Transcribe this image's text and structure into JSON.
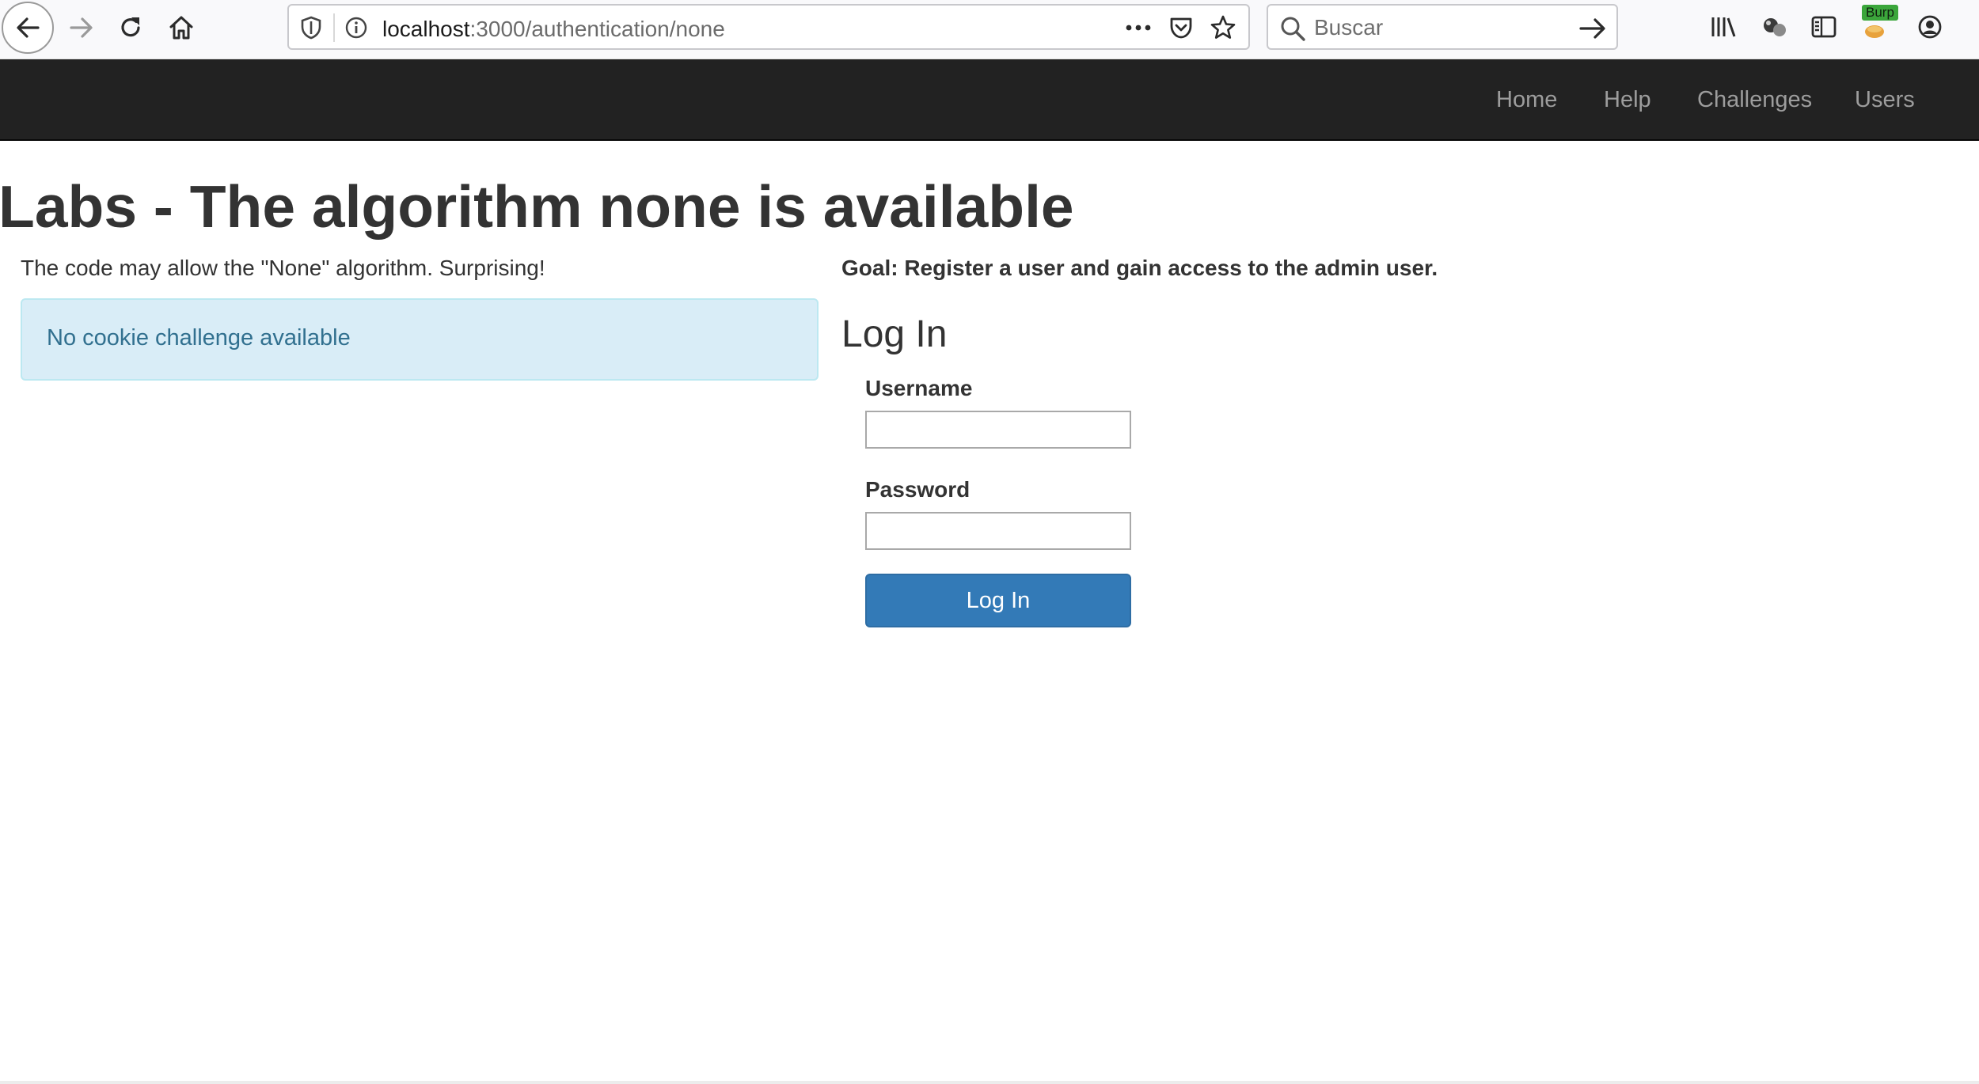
{
  "browser": {
    "url_host": "localhost",
    "url_path": ":3000/authentication/none",
    "search_placeholder": "Buscar",
    "burp_badge": "Burp",
    "icons": [
      "back-arrow-icon",
      "forward-arrow-icon",
      "reload-icon",
      "home-icon",
      "shield-icon",
      "info-icon",
      "more-dots-icon",
      "pocket-icon",
      "star-icon",
      "search-icon",
      "go-arrow-icon",
      "library-icon",
      "extension-icon",
      "sidebar-icon",
      "burp-icon",
      "account-icon"
    ]
  },
  "nav": {
    "items": [
      "Home",
      "Help",
      "Challenges",
      "Users"
    ]
  },
  "page": {
    "title": "Labs - The algorithm none is available",
    "lead": "The code may allow the \"None\" algorithm. Surprising!",
    "alert": "No cookie challenge available",
    "goal": "Goal: Register a user and gain access to the admin user.",
    "login": {
      "heading": "Log In",
      "username_label": "Username",
      "username_value": "",
      "password_label": "Password",
      "password_value": "",
      "button": "Log In"
    }
  },
  "colors": {
    "navbar_bg": "#222222",
    "nav_link": "#9d9d9d",
    "alert_bg": "#d9edf7",
    "alert_text": "#31708f",
    "primary_button": "#337ab7",
    "burp_badge": "#3ba63b"
  }
}
